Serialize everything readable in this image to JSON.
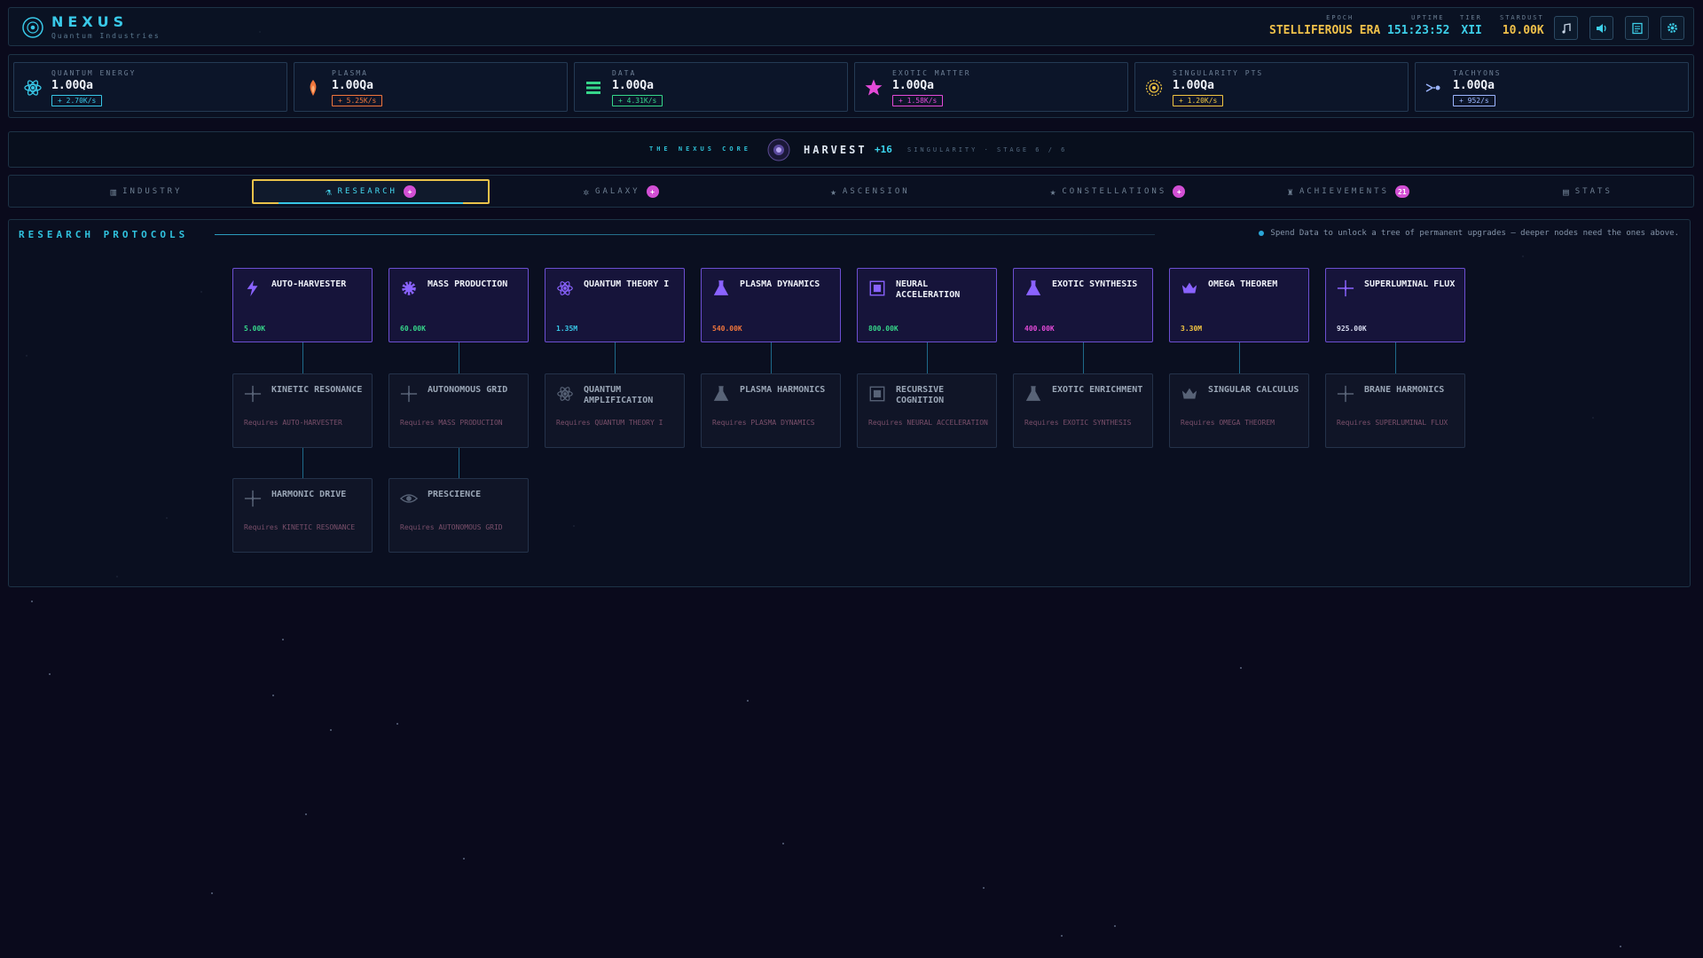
{
  "header": {
    "brand": "NEXUS",
    "brand_sub": "Quantum Industries",
    "epoch_label": "EPOCH",
    "epoch_value": "STELLIFEROUS ERA",
    "uptime_label": "UPTIME",
    "uptime_value": "151:23:52",
    "tier_label": "TIER",
    "tier_value": "XII",
    "stardust_label": "STARDUST",
    "stardust_value": "10.00K",
    "buttons": [
      "music-icon",
      "speaker-icon",
      "log-icon",
      "gear-icon"
    ]
  },
  "resources": [
    {
      "label": "QUANTUM ENERGY",
      "value": "1.00Qa",
      "rate": "+ 2.70K/s",
      "color": "#38c6e6",
      "icon": "atom-icon"
    },
    {
      "label": "PLASMA",
      "value": "1.00Qa",
      "rate": "+ 5.25K/s",
      "color": "#f0763c",
      "icon": "flame-icon"
    },
    {
      "label": "DATA",
      "value": "1.00Qa",
      "rate": "+ 4.31K/s",
      "color": "#36d68a",
      "icon": "data-icon"
    },
    {
      "label": "EXOTIC MATTER",
      "value": "1.00Qa",
      "rate": "+ 1.58K/s",
      "color": "#e44ad8",
      "icon": "star-icon"
    },
    {
      "label": "SINGULARITY PTS",
      "value": "1.00Qa",
      "rate": "+ 1.20K/s",
      "color": "#f2c542",
      "icon": "singularity-icon"
    },
    {
      "label": "TACHYONS",
      "value": "1.00Qa",
      "rate": "+ 952/s",
      "color": "#9db6ff",
      "icon": "tachyon-icon"
    }
  ],
  "core": {
    "title": "THE NEXUS CORE",
    "action": "HARVEST",
    "gain": "+16",
    "stage": "SINGULARITY · STAGE 6 / 6"
  },
  "tabs": [
    {
      "label": "INDUSTRY",
      "icon": "▥",
      "badge": "",
      "active": false
    },
    {
      "label": "RESEARCH",
      "icon": "⚗",
      "badge": "+",
      "active": true
    },
    {
      "label": "GALAXY",
      "icon": "✲",
      "badge": "+",
      "active": false
    },
    {
      "label": "ASCENSION",
      "icon": "★",
      "badge": "",
      "active": false
    },
    {
      "label": "CONSTELLATIONS",
      "icon": "★",
      "badge": "+",
      "active": false
    },
    {
      "label": "ACHIEVEMENTS",
      "icon": "♜",
      "badge": "21",
      "active": false
    },
    {
      "label": "STATS",
      "icon": "▤",
      "badge": "",
      "active": false
    }
  ],
  "research": {
    "title": "RESEARCH PROTOCOLS",
    "hint": "Spend Data to unlock a tree of permanent upgrades — deeper nodes need the ones above.",
    "tier1": [
      {
        "name": "AUTO-HARVESTER",
        "cost": "5.00K",
        "cost_color": "#36d68a",
        "icon": "bolt-icon"
      },
      {
        "name": "MASS PRODUCTION",
        "cost": "60.00K",
        "cost_color": "#36d68a",
        "icon": "gear-icon"
      },
      {
        "name": "QUANTUM THEORY I",
        "cost": "1.35M",
        "cost_color": "#38c6e6",
        "icon": "atom-icon"
      },
      {
        "name": "PLASMA DYNAMICS",
        "cost": "540.00K",
        "cost_color": "#f0763c",
        "icon": "flask-icon"
      },
      {
        "name": "NEURAL ACCELERATION",
        "cost": "800.00K",
        "cost_color": "#36d68a",
        "icon": "chip-icon"
      },
      {
        "name": "EXOTIC SYNTHESIS",
        "cost": "400.00K",
        "cost_color": "#e44ad8",
        "icon": "flask-icon"
      },
      {
        "name": "OMEGA THEOREM",
        "cost": "3.30M",
        "cost_color": "#f2c542",
        "icon": "crown-icon"
      },
      {
        "name": "SUPERLUMINAL FLUX",
        "cost": "925.00K",
        "cost_color": "#d8dcf0",
        "icon": "sparkle-icon"
      }
    ],
    "tier2": [
      {
        "name": "KINETIC RESONANCE",
        "req": "Requires AUTO-HARVESTER",
        "icon": "sparkle-icon"
      },
      {
        "name": "AUTONOMOUS GRID",
        "req": "Requires MASS PRODUCTION",
        "icon": "sparkle-icon"
      },
      {
        "name": "QUANTUM AMPLIFICATION",
        "req": "Requires QUANTUM THEORY I",
        "icon": "atom-icon"
      },
      {
        "name": "PLASMA HARMONICS",
        "req": "Requires PLASMA DYNAMICS",
        "icon": "flask-icon"
      },
      {
        "name": "RECURSIVE COGNITION",
        "req": "Requires NEURAL ACCELERATION",
        "icon": "chip-icon"
      },
      {
        "name": "EXOTIC ENRICHMENT",
        "req": "Requires EXOTIC SYNTHESIS",
        "icon": "flask-icon"
      },
      {
        "name": "SINGULAR CALCULUS",
        "req": "Requires OMEGA THEOREM",
        "icon": "crown-icon"
      },
      {
        "name": "BRANE HARMONICS",
        "req": "Requires SUPERLUMINAL FLUX",
        "icon": "sparkle-icon"
      }
    ],
    "tier3": [
      {
        "name": "HARMONIC DRIVE",
        "req": "Requires KINETIC RESONANCE",
        "icon": "sparkle-icon"
      },
      {
        "name": "PRESCIENCE",
        "req": "Requires AUTONOMOUS GRID",
        "icon": "eye-icon"
      }
    ]
  }
}
